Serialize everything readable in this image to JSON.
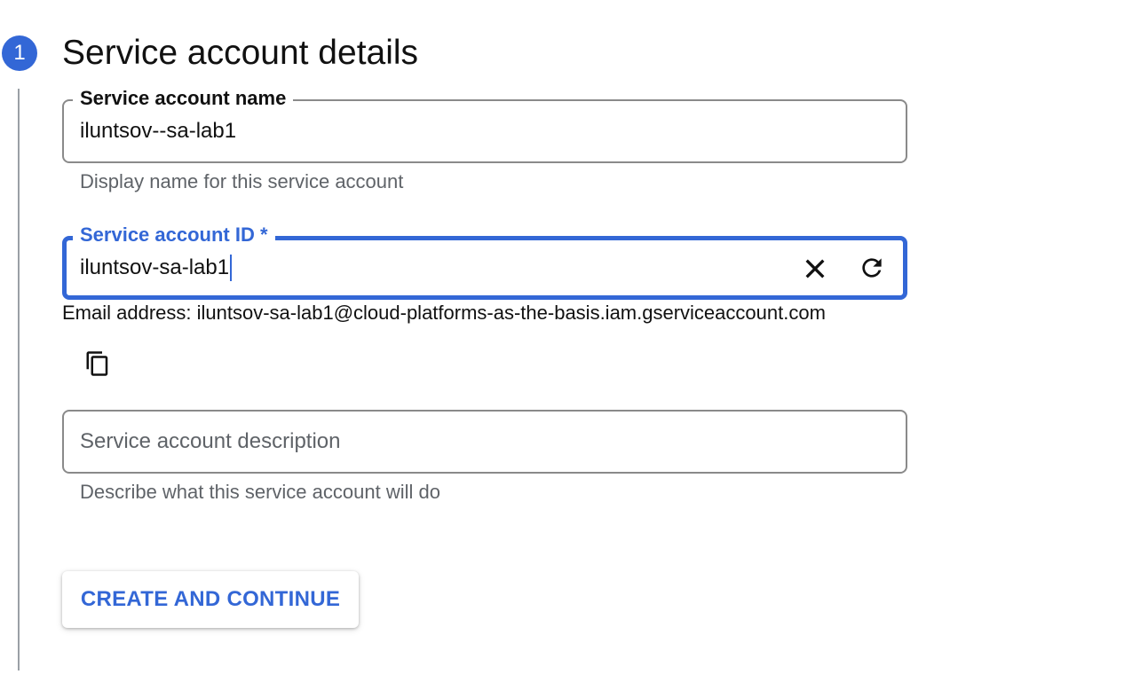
{
  "step": {
    "number": "1",
    "title": "Service account details"
  },
  "name_field": {
    "label": "Service account name",
    "value": "iluntsov--sa-lab1",
    "hint": "Display name for this service account"
  },
  "id_field": {
    "label": "Service account ID *",
    "value": "iluntsov-sa-lab1",
    "clear_icon": "close-icon",
    "refresh_icon": "refresh-icon",
    "email_text": "Email address: iluntsov-sa-lab1@cloud-platforms-as-the-basis.iam.gserviceaccount.com",
    "copy_icon": "copy-icon"
  },
  "description_field": {
    "placeholder": "Service account description",
    "hint": "Describe what this service account will do"
  },
  "actions": {
    "create_label": "CREATE AND CONTINUE"
  },
  "colors": {
    "accent": "#3367d6",
    "border": "#8a8a8a",
    "hint_text": "#5f6368"
  }
}
